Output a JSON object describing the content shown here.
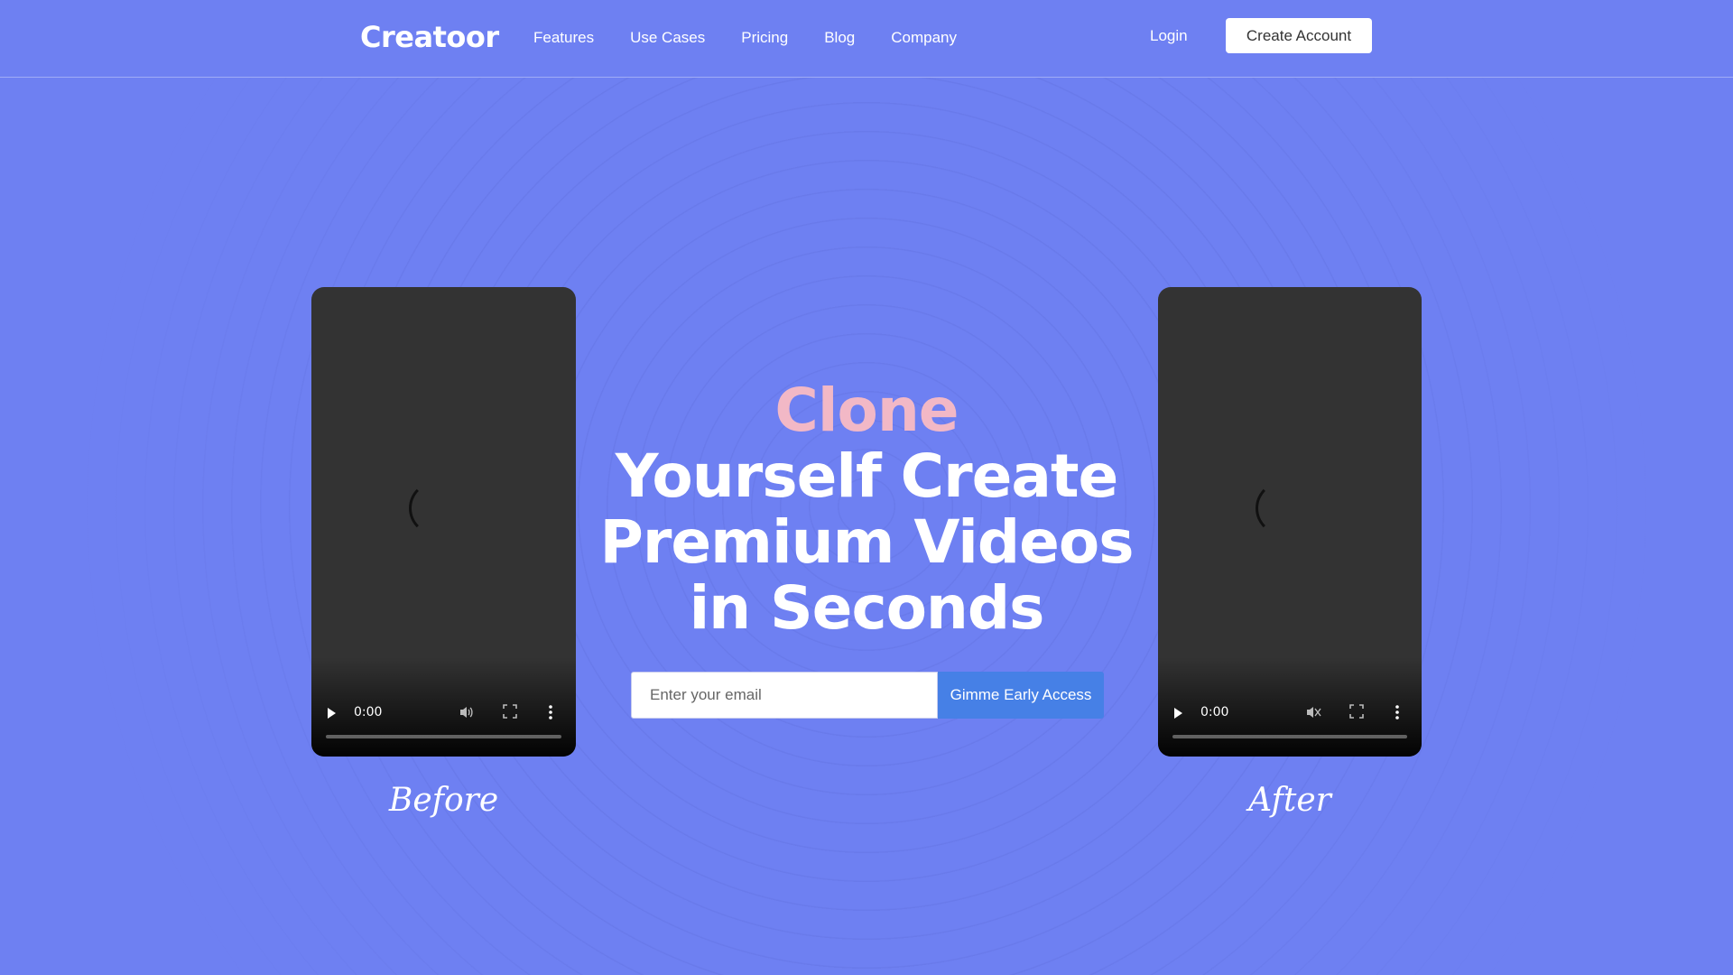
{
  "header": {
    "logo": "Creatoor",
    "nav": [
      "Features",
      "Use Cases",
      "Pricing",
      "Blog",
      "Company"
    ],
    "login": "Login",
    "create_account": "Create Account"
  },
  "hero": {
    "accent": "Clone",
    "title": "Yourself Create Premium Videos in Seconds",
    "email_placeholder": "Enter your email",
    "cta": "Gimme Early Access"
  },
  "videos": {
    "before": {
      "time": "0:00",
      "caption": "Before",
      "muted": false
    },
    "after": {
      "time": "0:00",
      "caption": "After",
      "muted": true
    }
  },
  "colors": {
    "background": "#6e80f2",
    "accent_text": "#f2b8c6",
    "cta_button": "#4680e6"
  }
}
